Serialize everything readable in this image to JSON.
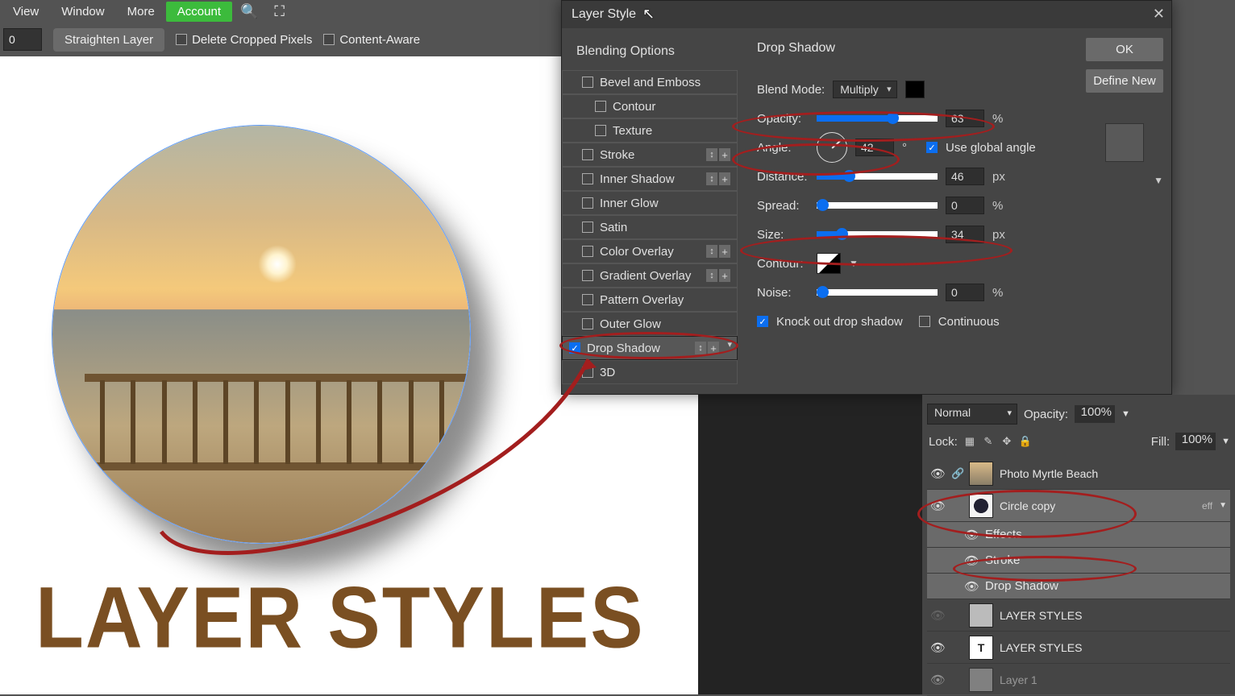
{
  "menu": {
    "view": "View",
    "window": "Window",
    "more": "More",
    "account": "Account"
  },
  "opt": {
    "num": "0",
    "straighten": "Straighten Layer",
    "delCrop": "Delete Cropped Pixels",
    "contentAware": "Content-Aware"
  },
  "big": "LAYER STYLES",
  "dlg": {
    "title": "Layer Style",
    "blending": "Blending Options",
    "effects": [
      "Bevel and Emboss",
      "Contour",
      "Texture",
      "Stroke",
      "Inner Shadow",
      "Inner Glow",
      "Satin",
      "Color Overlay",
      "Gradient Overlay",
      "Pattern Overlay",
      "Outer Glow",
      "Drop Shadow",
      "3D"
    ],
    "section": "Drop Shadow",
    "blendMode": "Blend Mode:",
    "blendVal": "Multiply",
    "opacity": "Opacity:",
    "opVal": "63",
    "opUnit": "%",
    "angle": "Angle:",
    "angVal": "42",
    "angUnit": "°",
    "useGlobal": "Use global angle",
    "distance": "Distance:",
    "distVal": "46",
    "distUnit": "px",
    "spread": "Spread:",
    "sprVal": "0",
    "sprUnit": "%",
    "size": "Size:",
    "sizeVal": "34",
    "sizeUnit": "px",
    "contour": "Contour:",
    "noise": "Noise:",
    "noiseVal": "0",
    "noiseUnit": "%",
    "knock": "Knock out drop shadow",
    "cont": "Continuous",
    "ok": "OK",
    "def": "Define New"
  },
  "lp": {
    "mode": "Normal",
    "opLab": "Opacity:",
    "opVal": "100%",
    "lock": "Lock:",
    "fill": "Fill:",
    "fillVal": "100%",
    "layers": [
      {
        "name": "Photo Myrtle Beach"
      },
      {
        "name": "Circle copy",
        "eff": "eff"
      },
      {
        "sub": true,
        "name": "Effects"
      },
      {
        "sub": true,
        "name": "Stroke"
      },
      {
        "sub": true,
        "name": "Drop Shadow"
      },
      {
        "name": "LAYER STYLES"
      },
      {
        "name": "LAYER STYLES",
        "T": true
      },
      {
        "name": "Layer 1"
      }
    ]
  }
}
